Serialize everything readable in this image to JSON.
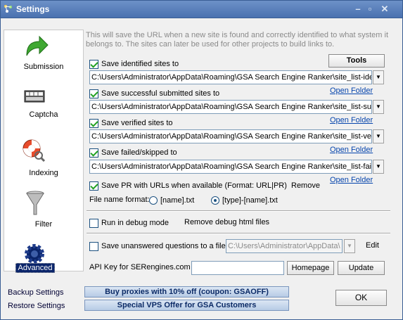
{
  "window": {
    "title": "Settings"
  },
  "sidebar": {
    "items": [
      {
        "label": "Submission",
        "icon": "green-arrow-icon"
      },
      {
        "label": "Captcha",
        "icon": "keyboard-icon"
      },
      {
        "label": "Indexing",
        "icon": "lifebuoy-icon"
      },
      {
        "label": "Filter",
        "icon": "funnel-icon"
      },
      {
        "label": "Advanced",
        "icon": "gear-icon"
      }
    ],
    "backup_label": "Backup Settings",
    "restore_label": "Restore Settings"
  },
  "intro": "This will save the URL when a new site is found and correctly identified to what system it belongs to. The sites can later be used for other projects to build links to.",
  "tools_label": "Tools",
  "identified": {
    "label": "Save identified sites to",
    "path": "C:\\Users\\Administrator\\AppData\\Roaming\\GSA Search Engine Ranker\\site_list-identified"
  },
  "submitted": {
    "label": "Save successful submitted sites to",
    "path": "C:\\Users\\Administrator\\AppData\\Roaming\\GSA Search Engine Ranker\\site_list-success"
  },
  "verified": {
    "label": "Save verified sites to",
    "path": "C:\\Users\\Administrator\\AppData\\Roaming\\GSA Search Engine Ranker\\site_list-verified"
  },
  "failed": {
    "label": "Save failed/skipped to",
    "path": "C:\\Users\\Administrator\\AppData\\Roaming\\GSA Search Engine Ranker\\site_list-failed"
  },
  "open_folder": "Open Folder",
  "pr": {
    "label": "Save PR with URLs when available (Format: URL|PR)",
    "remove": "Remove"
  },
  "file_format": {
    "label": "File name format:",
    "option1": "[name].txt",
    "option2": "[type]-[name].txt"
  },
  "debug": {
    "label": "Run in debug mode",
    "remove": "Remove debug html files"
  },
  "unanswered": {
    "label": "Save unanswered questions to a file",
    "path": "C:\\Users\\Administrator\\AppData\\",
    "edit": "Edit"
  },
  "api": {
    "label": "API Key for SERengines.com",
    "value": "",
    "homepage": "Homepage",
    "update": "Update"
  },
  "promo1": "Buy proxies with 10% off  (coupon: GSAOFF)",
  "promo2": "Special VPS Offer for GSA Customers",
  "ok_label": "OK"
}
